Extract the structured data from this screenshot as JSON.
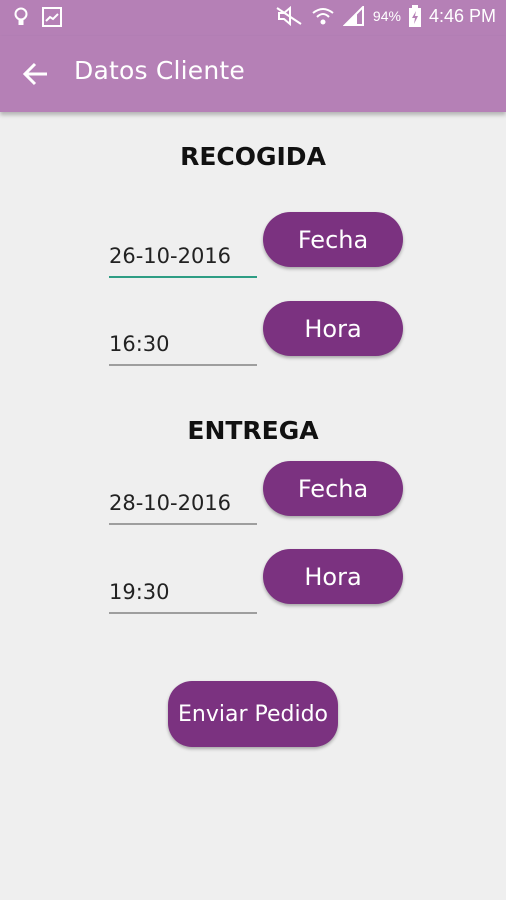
{
  "status_bar": {
    "time": "4:46 PM",
    "battery_percent": "94%",
    "icons": [
      "bulb-icon",
      "image-icon",
      "mute-icon",
      "wifi-icon",
      "signal-icon",
      "battery-charging-icon"
    ]
  },
  "app_bar": {
    "title": "Datos Cliente",
    "back_icon": "arrow-back-icon"
  },
  "recogida": {
    "title": "RECOGIDA",
    "date_value": "26-10-2016",
    "date_button": "Fecha",
    "time_value": "16:30",
    "time_button": "Hora"
  },
  "entrega": {
    "title": "ENTREGA",
    "date_value": "28-10-2016",
    "date_button": "Fecha",
    "time_value": "19:30",
    "time_button": "Hora"
  },
  "submit_label": "Enviar Pedido",
  "colors": {
    "app_bar": "#b580b6",
    "button": "#7b3280",
    "focus_underline": "#2e9d84",
    "background": "#efefef"
  }
}
